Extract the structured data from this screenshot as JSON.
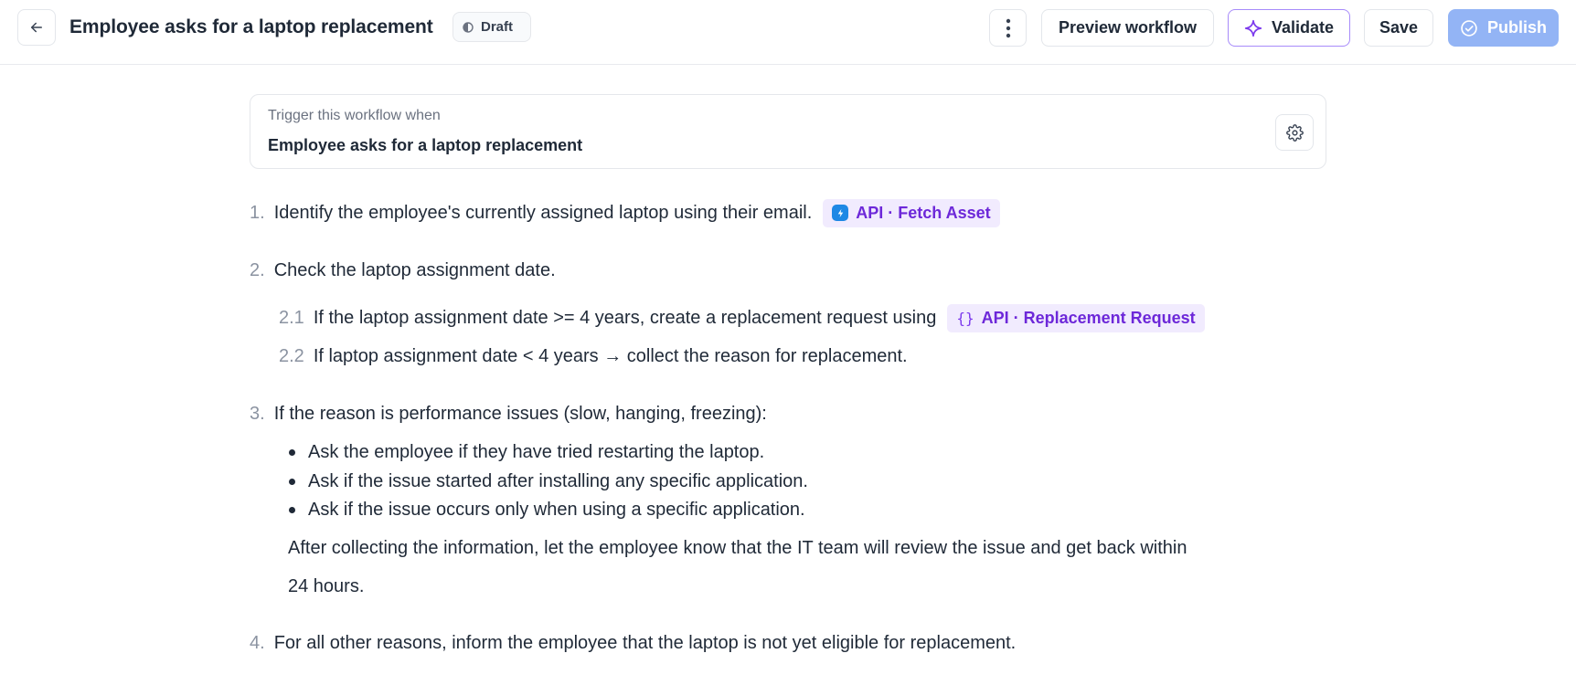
{
  "header": {
    "title": "Employee asks for a laptop replacement",
    "status": "Draft",
    "buttons": {
      "preview": "Preview workflow",
      "validate": "Validate",
      "save": "Save",
      "publish": "Publish"
    }
  },
  "trigger": {
    "label": "Trigger this workflow when",
    "value": "Employee asks for a laptop replacement"
  },
  "steps": [
    {
      "number": "1.",
      "text": "Identify the employee's currently assigned laptop using their email.",
      "chip": "API · Fetch Asset"
    },
    {
      "number": "2.",
      "text": "Check the laptop assignment date.",
      "substeps": [
        {
          "number": "2.1",
          "text": "If the laptop assignment date >= 4 years, create a replacement request using",
          "chip": "API · Replacement Request"
        },
        {
          "number": "2.2",
          "text": "If laptop assignment date < 4 years → collect the reason for replacement."
        }
      ]
    },
    {
      "number": "3.",
      "text": "If the reason is performance issues (slow, hanging, freezing):",
      "bullets": [
        "Ask the employee if they have tried restarting the laptop.",
        "Ask if the issue started after installing any specific application.",
        "Ask if the issue occurs only when using a specific application."
      ],
      "note_line1": "After collecting the information, let the employee know that the IT team will review the issue and get back within",
      "note_line2": "24 hours."
    },
    {
      "number": "4.",
      "text": "For all other reasons, inform the employee that the laptop is not yet eligible for replacement."
    }
  ],
  "colors": {
    "accent_purple": "#6d28d9",
    "chip_bg": "#f1ebfe",
    "publish_bg": "#93b4f5",
    "validate_border": "#a78bfa"
  }
}
